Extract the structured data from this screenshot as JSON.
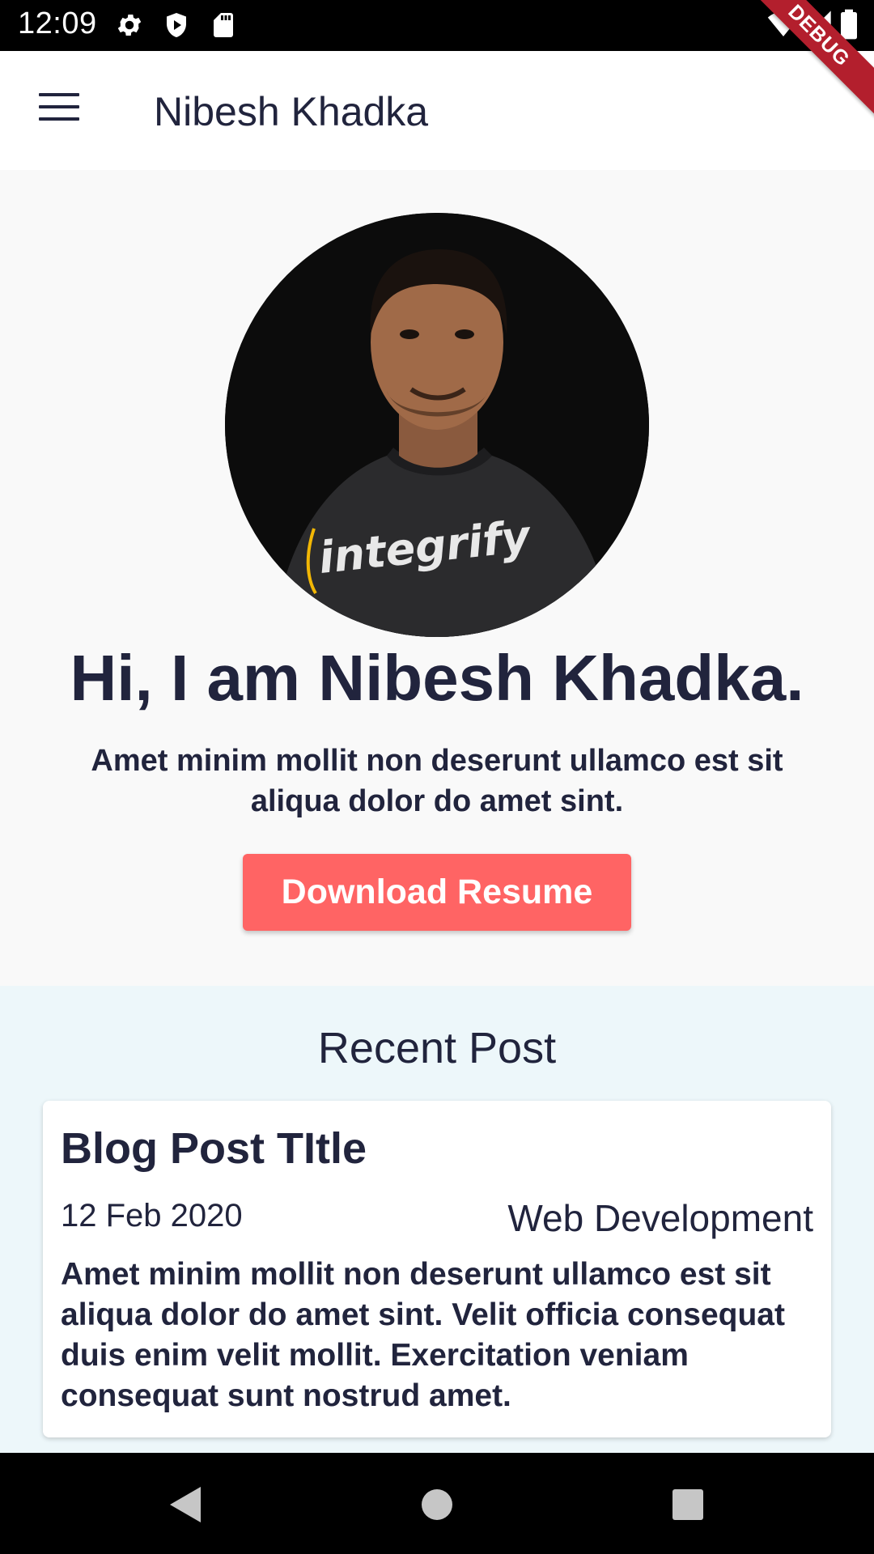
{
  "status_bar": {
    "time": "12:09",
    "left_icons": [
      "gear-icon",
      "shield-play-icon",
      "sd-card-icon"
    ],
    "right_icons": [
      "wifi-icon",
      "signal-icon",
      "battery-icon"
    ]
  },
  "debug_banner": "DEBUG",
  "app_bar": {
    "title": "Nibesh Khadka",
    "menu_icon": "hamburger-menu-icon"
  },
  "hero": {
    "avatar_shirt_text": "integrify",
    "heading": "Hi, I am Nibesh Khadka.",
    "subtitle": "Amet minim mollit non deserunt ullamco est sit aliqua dolor do amet sint.",
    "button_label": "Download Resume",
    "button_color": "#ff6464"
  },
  "recent": {
    "section_title": "Recent Post",
    "posts": [
      {
        "title": "Blog Post TItle",
        "date": "12 Feb 2020",
        "category": "Web Development",
        "excerpt": "Amet minim mollit non deserunt ullamco est sit aliqua dolor do amet sint. Velit officia consequat duis enim velit mollit. Exercitation veniam consequat sunt nostrud amet."
      }
    ]
  },
  "nav_bar": {
    "buttons": [
      "back-icon",
      "home-icon",
      "recents-icon"
    ]
  },
  "colors": {
    "text_dark": "#21243d",
    "accent": "#ff6464",
    "recent_bg": "#edf7fa",
    "hero_bg": "#f9f9f9"
  }
}
